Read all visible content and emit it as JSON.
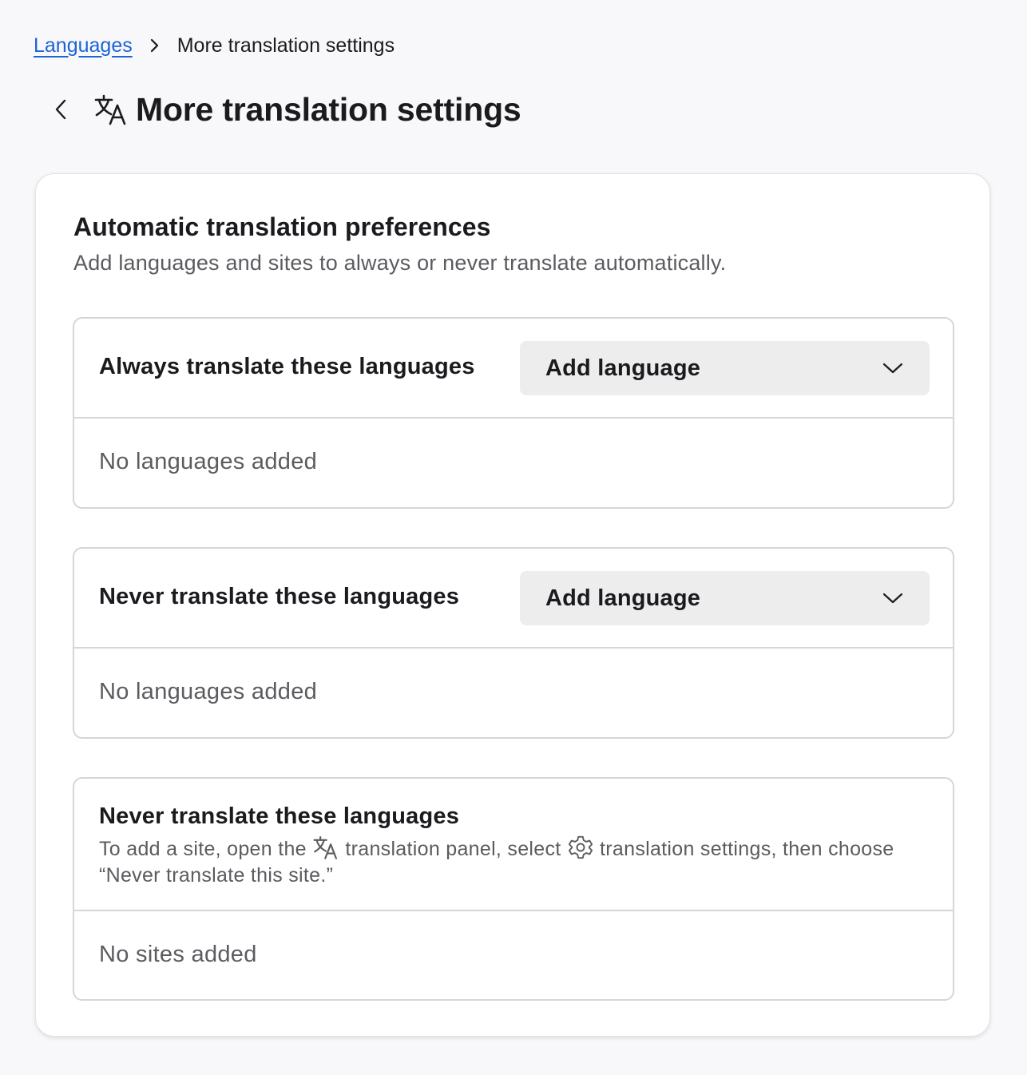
{
  "breadcrumb": {
    "parent": "Languages",
    "current": "More translation settings"
  },
  "header": {
    "title": "More translation settings",
    "icon": "translate-icon"
  },
  "card": {
    "title": "Automatic translation preferences",
    "subtitle": "Add languages and sites to always or never translate automatically."
  },
  "always_section": {
    "label": "Always translate these languages",
    "dropdown_label": "Add language",
    "empty_text": "No languages added"
  },
  "never_section": {
    "label": "Never translate these languages",
    "dropdown_label": "Add language",
    "empty_text": "No languages added"
  },
  "sites_section": {
    "title": "Never translate these languages",
    "desc_part1": "To add a site, open the",
    "desc_part2": "translation panel, select",
    "desc_part3": "translation settings, then choose “Never translate this site.”",
    "empty_text": "No sites added"
  },
  "colors": {
    "link": "#1a63d8",
    "background": "#f8f8fa",
    "dropdown_bg": "#ededed"
  }
}
